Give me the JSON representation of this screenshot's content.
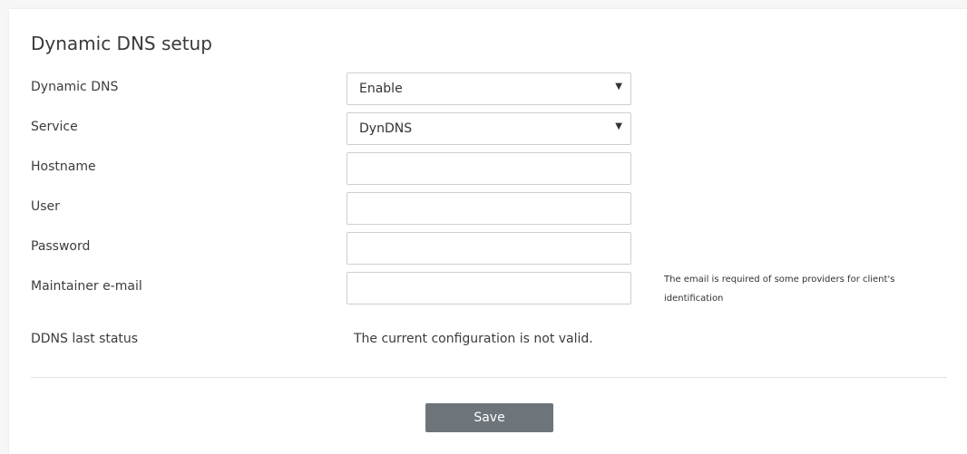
{
  "page": {
    "title": "Dynamic DNS setup"
  },
  "form": {
    "dynamic_dns": {
      "label": "Dynamic DNS",
      "value": "Enable"
    },
    "service": {
      "label": "Service",
      "value": "DynDNS"
    },
    "hostname": {
      "label": "Hostname",
      "value": "",
      "placeholder": ""
    },
    "user": {
      "label": "User",
      "value": "",
      "placeholder": ""
    },
    "password": {
      "label": "Password",
      "value": "",
      "placeholder": ""
    },
    "maintainer_email": {
      "label": "Maintainer e-mail",
      "value": "",
      "placeholder": "",
      "help": "The email is required of some providers for client's identification"
    },
    "ddns_status": {
      "label": "DDNS last status",
      "value": "The current configuration is not valid."
    }
  },
  "actions": {
    "save_label": "Save"
  },
  "icons": {
    "dropdown_caret": "▼"
  },
  "colors": {
    "save_button": "#6d757b",
    "background": "#f7f7f7",
    "panel": "#ffffff"
  }
}
